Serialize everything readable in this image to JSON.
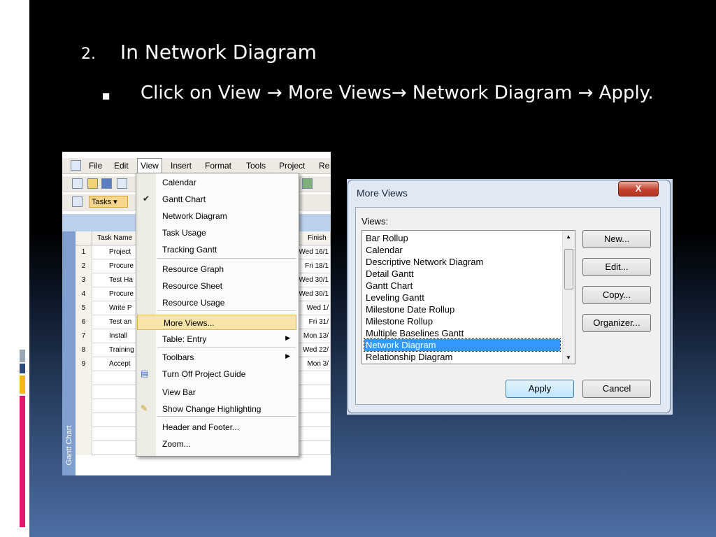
{
  "slide": {
    "number": "2.",
    "heading": "In Network Diagram",
    "bullet": "Click on View → More Views→ Network Diagram → Apply."
  },
  "project_window": {
    "menu": [
      "File",
      "Edit",
      "View",
      "Insert",
      "Format",
      "Tools",
      "Project",
      "Re"
    ],
    "tasks_dropdown": "Tasks",
    "columns": {
      "task_name": "Task Name",
      "finish": "Finish"
    },
    "rows": [
      {
        "id": "1",
        "name": "Project",
        "finish": "Wed 16/1"
      },
      {
        "id": "2",
        "name": "Procure",
        "finish": "Fri 18/1"
      },
      {
        "id": "3",
        "name": "Test Ha",
        "finish": "Wed 30/1"
      },
      {
        "id": "4",
        "name": "Procure",
        "finish": "Wed 30/1"
      },
      {
        "id": "5",
        "name": "Write P",
        "finish": "Wed 1/"
      },
      {
        "id": "6",
        "name": "Test an",
        "finish": "Fri 31/"
      },
      {
        "id": "7",
        "name": "Install",
        "finish": "Mon 13/"
      },
      {
        "id": "8",
        "name": "Training",
        "finish": "Wed 22/"
      },
      {
        "id": "9",
        "name": "Accept",
        "finish": "Mon 3/"
      }
    ],
    "side_label": "Gantt Chart"
  },
  "view_menu": {
    "items": [
      {
        "label": "Calendar"
      },
      {
        "label": "Gantt Chart",
        "icon": "check-icon"
      },
      {
        "label": "Network Diagram"
      },
      {
        "label": "Task Usage"
      },
      {
        "label": "Tracking Gantt"
      },
      {
        "label": "Resource Graph"
      },
      {
        "label": "Resource Sheet"
      },
      {
        "label": "Resource Usage"
      },
      {
        "label": "More Views..."
      },
      {
        "label": "Table: Entry"
      },
      {
        "label": "Toolbars"
      },
      {
        "label": "Turn Off Project Guide",
        "icon": "project-guide-icon"
      },
      {
        "label": "View Bar"
      },
      {
        "label": "Show Change Highlighting",
        "icon": "highlight-icon"
      },
      {
        "label": "Header and Footer..."
      },
      {
        "label": "Zoom..."
      }
    ]
  },
  "more_views_dialog": {
    "title": "More Views",
    "close": "X",
    "views_label": "Views:",
    "views": [
      "Bar Rollup",
      "Calendar",
      "Descriptive Network Diagram",
      "Detail Gantt",
      "Gantt Chart",
      "Leveling Gantt",
      "Milestone Date Rollup",
      "Milestone Rollup",
      "Multiple Baselines Gantt",
      "Network Diagram",
      "Relationship Diagram"
    ],
    "selected": "Network Diagram",
    "buttons": {
      "new": "New...",
      "edit": "Edit...",
      "copy": "Copy...",
      "organizer": "Organizer...",
      "apply": "Apply",
      "cancel": "Cancel"
    }
  }
}
